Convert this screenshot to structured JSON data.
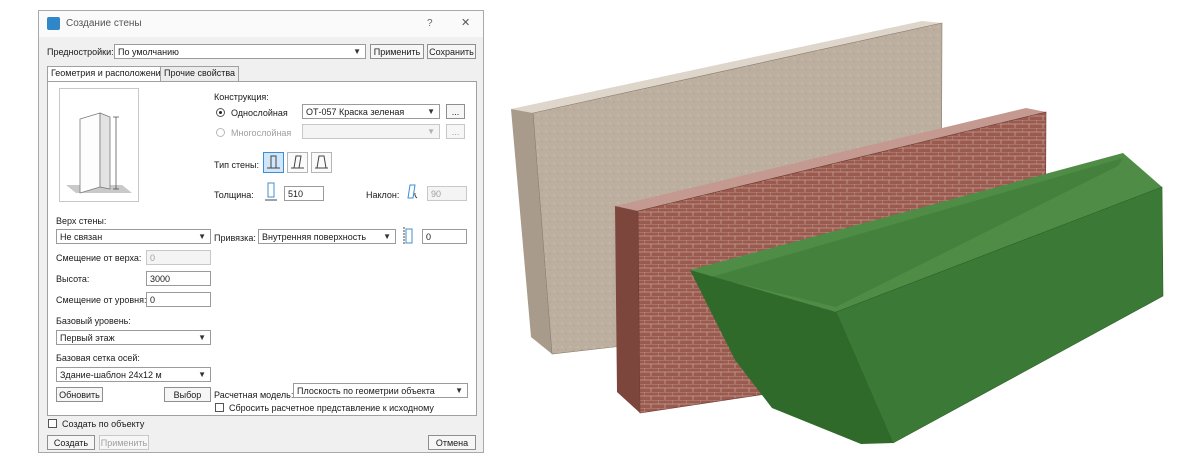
{
  "window": {
    "title": "Создание стены",
    "help": "?",
    "close": "✕"
  },
  "presets": {
    "label": "Предностройки:",
    "value": "По умолчанию",
    "apply": "Применить",
    "save": "Сохранить"
  },
  "tabs": [
    "Геометрия и расположение",
    "Прочие свойства"
  ],
  "left": {
    "top_label": "Верх стены:",
    "top_value": "Не связан",
    "offset_top_label": "Смещение от верха:",
    "offset_top_value": "0",
    "height_label": "Высота:",
    "height_value": "3000",
    "offset_level_label": "Смещение от уровня:",
    "offset_level_value": "0",
    "base_level_label": "Базовый уровень:",
    "base_level_value": "Первый этаж",
    "grid_label": "Базовая сетка осей:",
    "grid_value": "Здание-шаблон 24х12 м",
    "refresh": "Обновить",
    "choose": "Выбор"
  },
  "right": {
    "construction_label": "Конструкция:",
    "single_label": "Однослойная",
    "single_value": "ОТ-057 Краска зеленая",
    "multi_label": "Многослойная",
    "more": "...",
    "wall_type_label": "Тип стены:",
    "thickness_label": "Толщина:",
    "thickness_value": "510",
    "slope_label": "Наклон:",
    "slope_value": "90",
    "binding_label": "Привязка:",
    "binding_value": "Внутренняя поверхность",
    "binding_offset": "0",
    "calc_label": "Расчетная модель:",
    "calc_value": "Плоскость по геометрии объекта",
    "reset_label": "Сбросить расчетное представление к исходному"
  },
  "bottom": {
    "by_object": "Создать по объекту",
    "create": "Создать",
    "apply": "Применить",
    "cancel": "Отмена"
  },
  "colors": {
    "stone": "#bfb09f",
    "brick": "#9a5a4e",
    "green": "#3b7a36"
  }
}
